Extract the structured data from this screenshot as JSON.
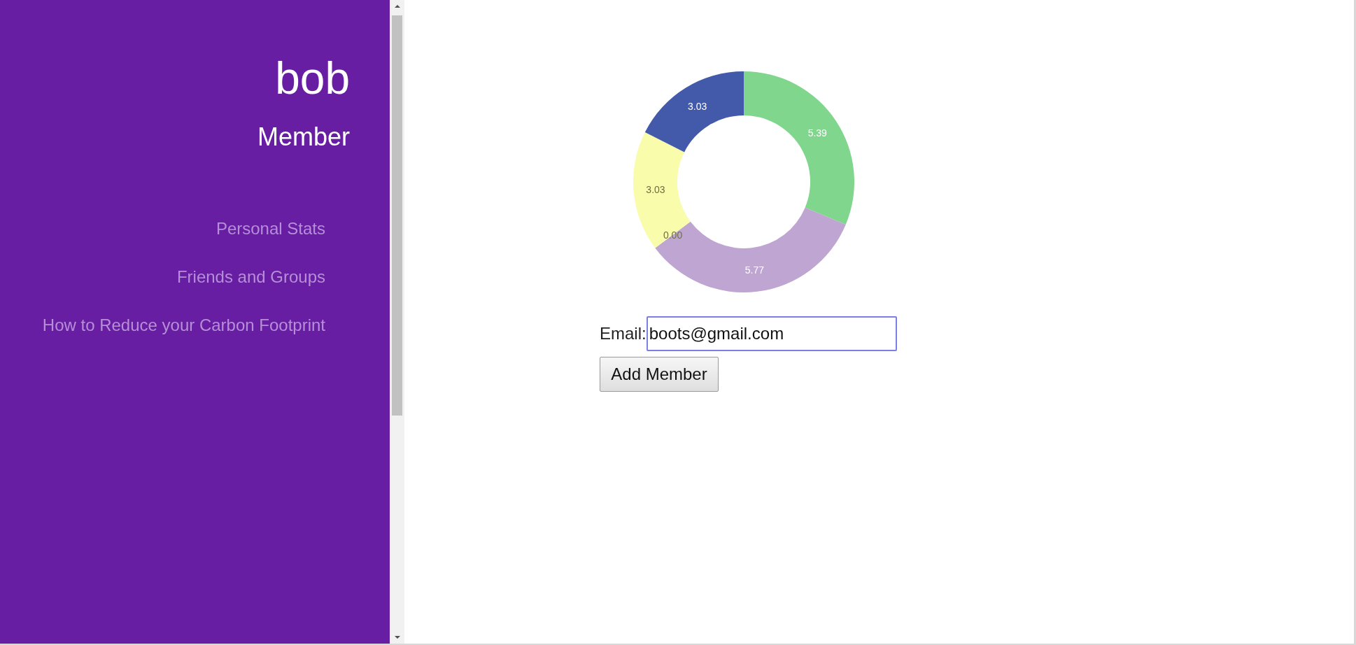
{
  "sidebar": {
    "user_name": "bob",
    "role": "Member",
    "items": [
      {
        "label": "Personal Stats"
      },
      {
        "label": "Friends and Groups"
      },
      {
        "label": "How to Reduce your Carbon Footprint"
      }
    ]
  },
  "main": {
    "chart_data": {
      "type": "donut",
      "values": [
        5.39,
        5.77,
        0.0,
        3.03,
        3.03
      ],
      "colors": [
        "#80d68c",
        "#bfa5d2",
        "#e57373",
        "#f9fcaa",
        "#435aab"
      ],
      "data_labels": true,
      "value_labels": [
        "5.39",
        "5.77",
        "0.00",
        "3.03",
        "3.03"
      ]
    },
    "email_label": "Email:",
    "email_field": {
      "value": "boots@gmail.com",
      "focused": true
    },
    "add_button": "Add Member"
  }
}
